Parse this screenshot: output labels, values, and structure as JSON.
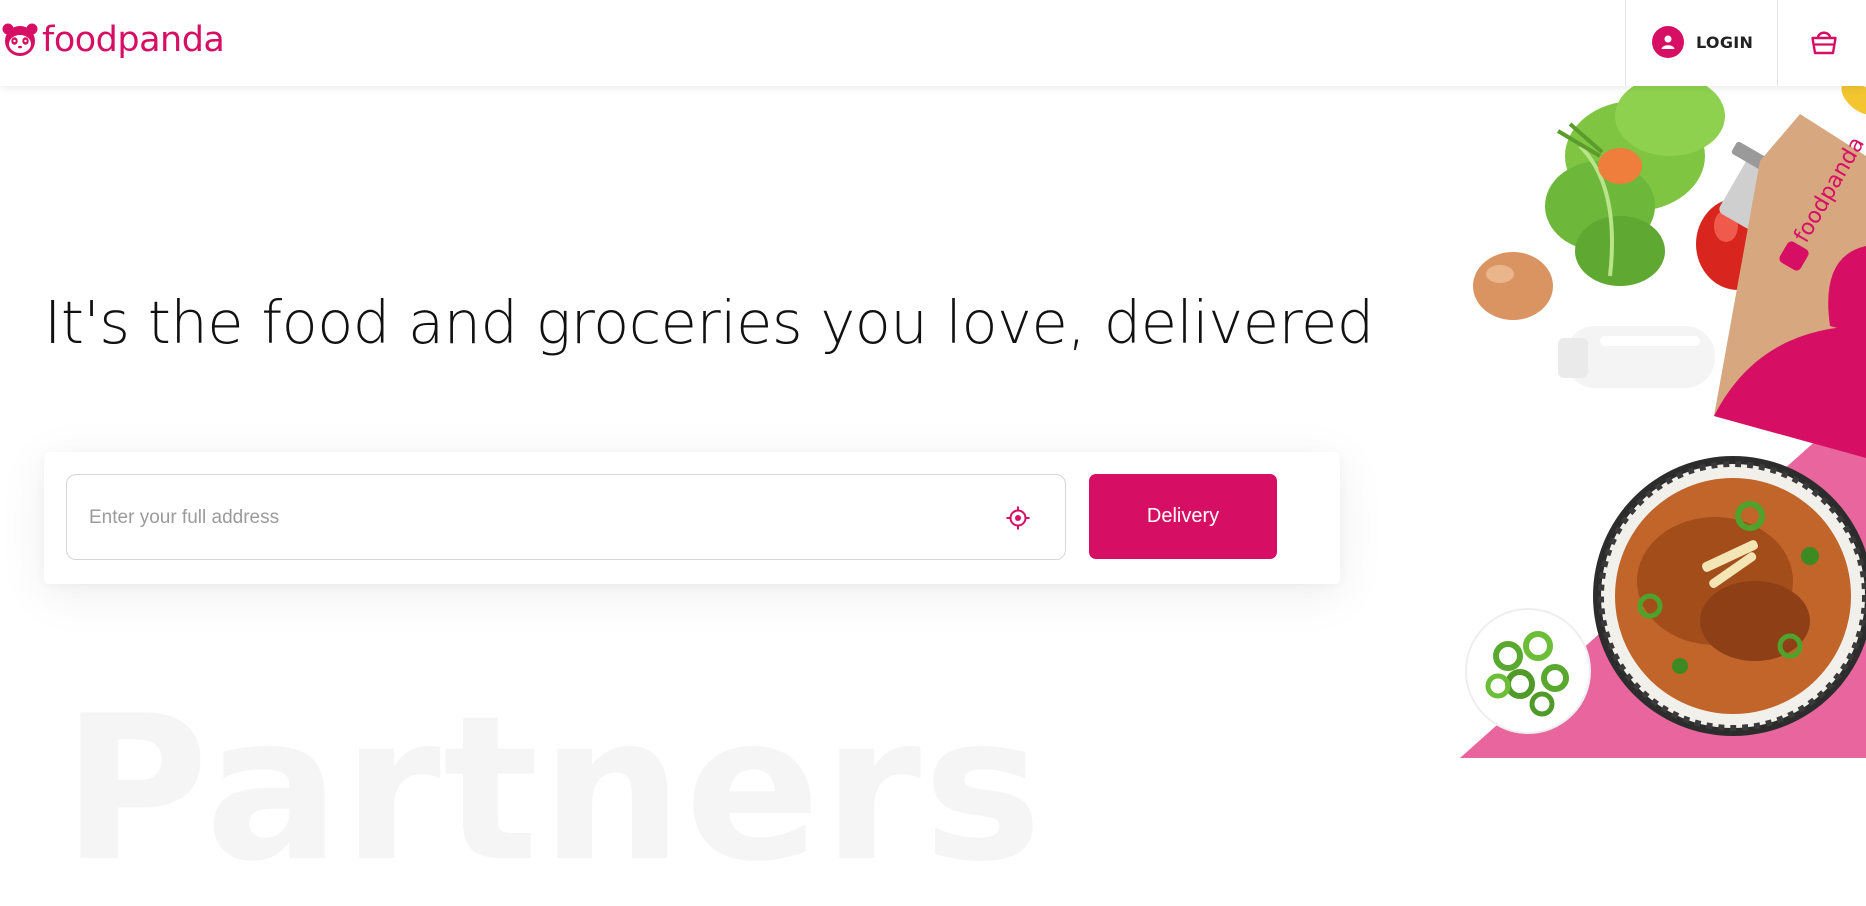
{
  "brand": {
    "name": "foodpanda",
    "color": "#d70f64"
  },
  "header": {
    "logo_icon": "panda-icon",
    "login_label": "LOGIN",
    "user_icon": "user-icon",
    "cart_icon": "shopping-basket-icon"
  },
  "hero": {
    "headline": "It's the food and groceries you love, delivered",
    "address_placeholder": "Enter your full address",
    "locate_icon": "locate-me-icon",
    "delivery_label": "Delivery",
    "bag_brand_text": "foodpanda"
  },
  "section_heading": "Partners"
}
